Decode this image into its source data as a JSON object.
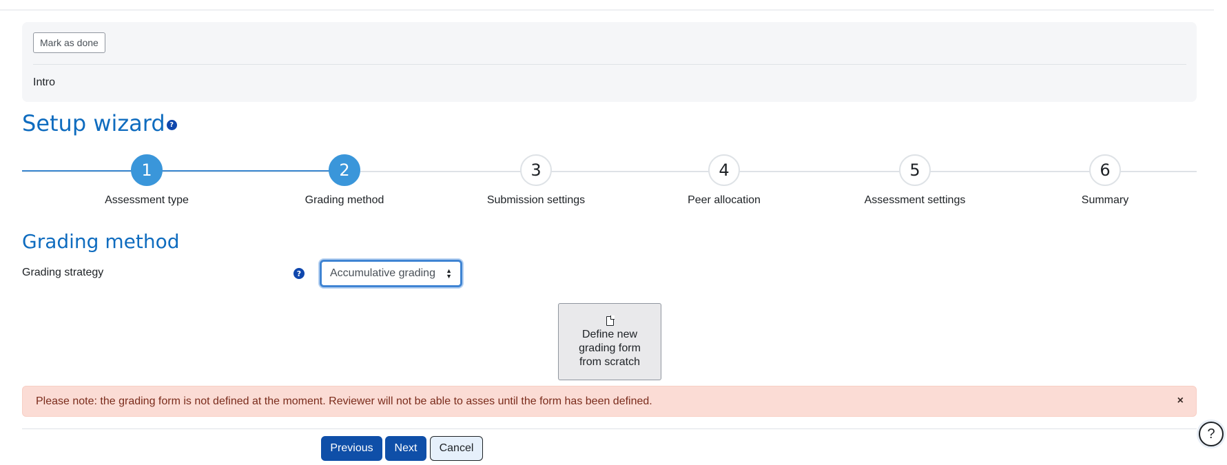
{
  "activity": {
    "mark_done_label": "Mark as done",
    "intro_label": "Intro"
  },
  "wizard": {
    "title": "Setup wizard",
    "help_symbol": "?",
    "steps": [
      {
        "number": "1",
        "label": "Assessment type",
        "state": "active"
      },
      {
        "number": "2",
        "label": "Grading method",
        "state": "active"
      },
      {
        "number": "3",
        "label": "Submission settings",
        "state": "pending"
      },
      {
        "number": "4",
        "label": "Peer allocation",
        "state": "pending"
      },
      {
        "number": "5",
        "label": "Assessment settings",
        "state": "pending"
      },
      {
        "number": "6",
        "label": "Summary",
        "state": "pending"
      }
    ]
  },
  "section": {
    "title": "Grading method",
    "field_label": "Grading strategy",
    "help_symbol": "?",
    "select_value": "Accumulative grading",
    "define_button_lines": [
      "Define new",
      "grading form",
      "from scratch"
    ],
    "define_button_icon": "document-icon"
  },
  "alert": {
    "message": "Please note: the grading form is not defined at the moment. Reviewer will not be able to asses until the form has been defined.",
    "close_symbol": "×"
  },
  "actions": {
    "previous_label": "Previous",
    "next_label": "Next",
    "cancel_label": "Cancel"
  },
  "floating_help": {
    "symbol": "?"
  },
  "colors": {
    "accent": "#0f6cbf",
    "step_active": "#3a96da",
    "primary_button": "#0f4fa8",
    "alert_bg": "#fbdcd5"
  }
}
